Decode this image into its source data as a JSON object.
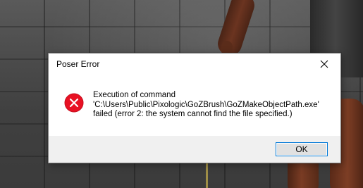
{
  "dialog": {
    "title": "Poser Error",
    "message_lines": [
      "Execution of command",
      "'C:\\Users\\Public\\Pixologic\\GoZBrush\\GoZMakeObjectPath.exe'",
      "failed (error 2: the system cannot find the file specified.)"
    ],
    "ok_label": "OK",
    "icon": "error-icon",
    "close_icon": "close-icon"
  },
  "colors": {
    "error_red": "#e81123",
    "button_focus_border": "#0078d7",
    "footer_bg": "#f0f0f0"
  }
}
